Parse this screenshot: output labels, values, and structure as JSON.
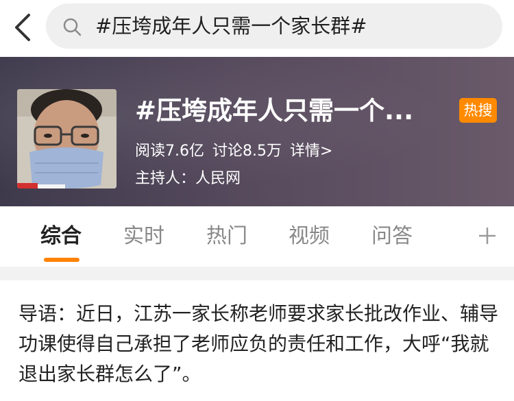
{
  "search": {
    "query": "#压垮成年人只需一个家长群#"
  },
  "topic": {
    "title": "#压垮成年人只需一个...",
    "badge": "热搜",
    "reads": "阅读7.6亿",
    "discussions": "讨论8.5万",
    "detail_link": "详情>",
    "host": "主持人：人民网"
  },
  "tabs": [
    {
      "label": "综合"
    },
    {
      "label": "实时"
    },
    {
      "label": "热门"
    },
    {
      "label": "视频"
    },
    {
      "label": "问答"
    }
  ],
  "intro": {
    "text": "导语：近日，江苏一家长称老师要求家长批改作业、辅导功课使得自己承担了老师应负的责任和工作，大呼“我就退出家长群怎么了”。"
  },
  "colors": {
    "accent": "#ff8200",
    "badge": "#ff8a00",
    "header_bg": "#4c4355"
  }
}
